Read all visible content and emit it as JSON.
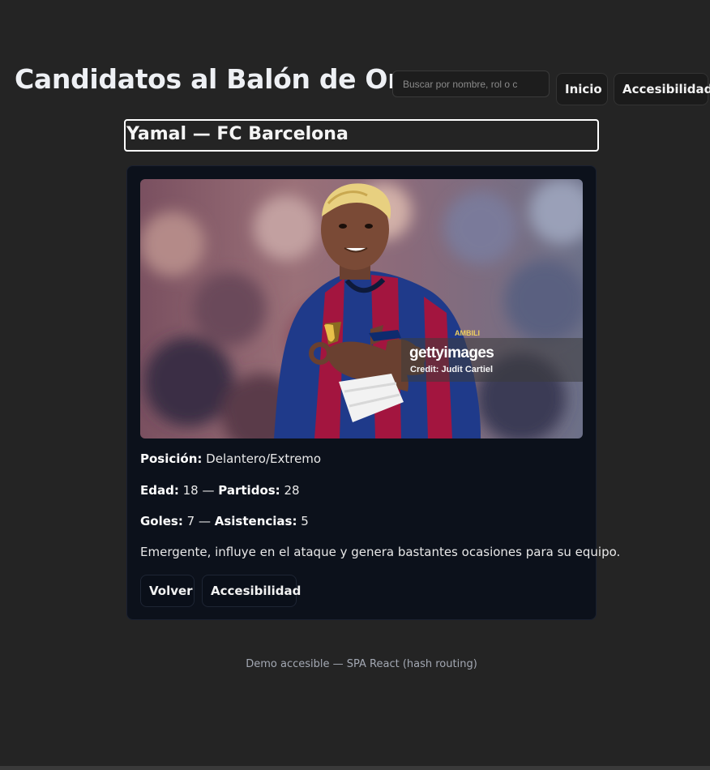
{
  "header": {
    "title": "Candidatos al Balón de Oro",
    "search_placeholder": "Buscar por nombre, rol o c",
    "nav": {
      "home_label": "Inicio",
      "accessibility_label": "Accesibilidad"
    }
  },
  "player": {
    "heading": "Yamal — FC Barcelona",
    "photo_alt": "Yamal",
    "watermark": {
      "logo": "gettyimages",
      "credit": "Credit: Judit Cartiel"
    },
    "position_label": "Posición:",
    "position_value": "Delantero/Extremo",
    "age_label": "Edad:",
    "age_value": "18",
    "matches_label": "Partidos:",
    "matches_value": "28",
    "goals_label": "Goles:",
    "goals_value": "7",
    "assists_label": "Asistencias:",
    "assists_value": "5",
    "separator": "—",
    "description": "Emergente, influye en el ataque y genera bastantes ocasiones para su equipo.",
    "back_label": "Volver",
    "accessibility_label": "Accesibilidad"
  },
  "footer": {
    "text": "Demo accesible — SPA React (hash routing)"
  },
  "colors": {
    "page_background": "#242424",
    "card_background": "#0c111b",
    "kit_blue": "#1f3a8a",
    "kit_garnet": "#a3153f"
  }
}
